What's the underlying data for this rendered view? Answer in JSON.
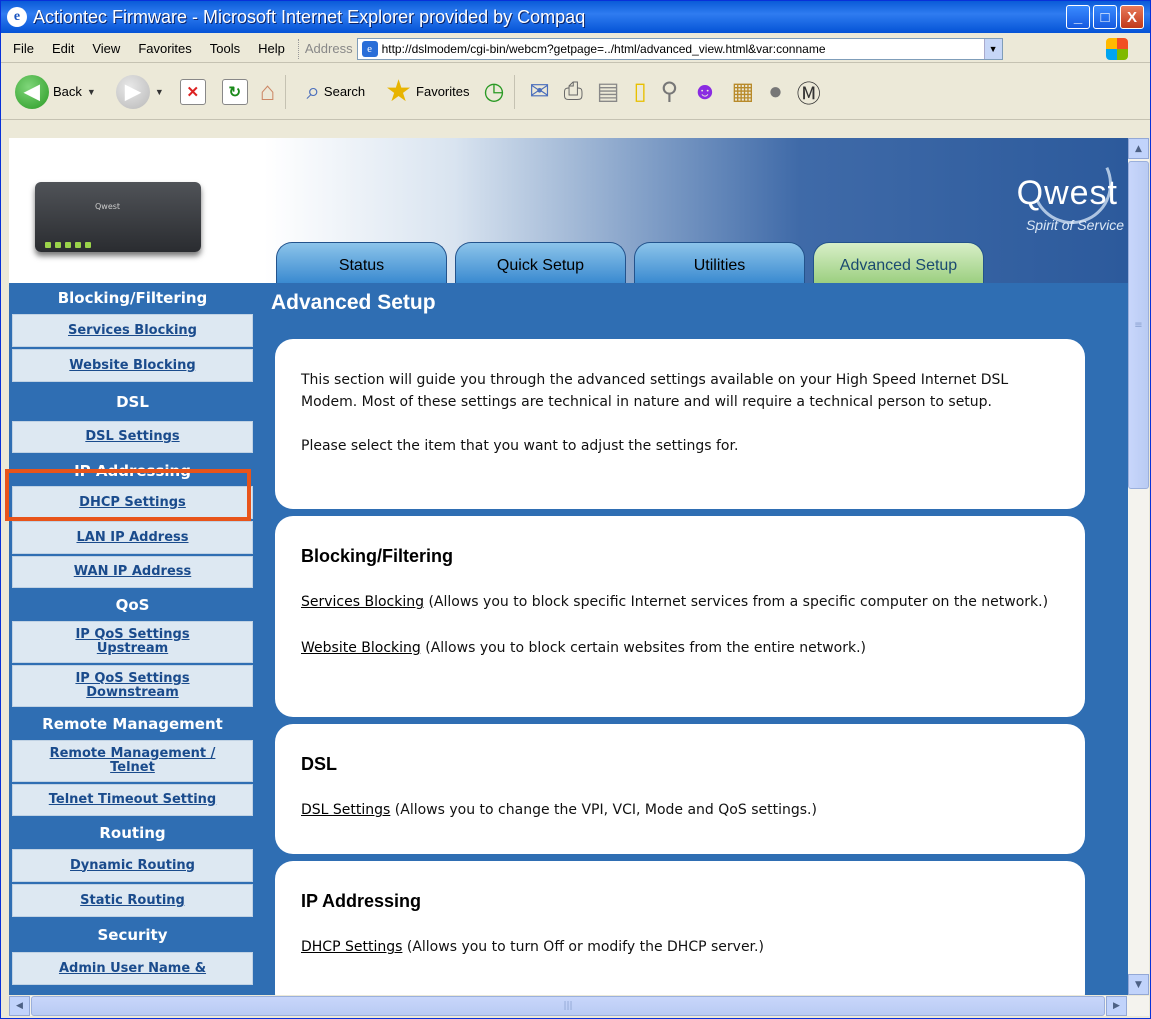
{
  "window": {
    "title": "Actiontec Firmware - Microsoft Internet Explorer provided by Compaq",
    "minimize": "_",
    "maximize": "□",
    "close": "X"
  },
  "menu": [
    "File",
    "Edit",
    "View",
    "Favorites",
    "Tools",
    "Help"
  ],
  "address": {
    "label": "Address",
    "url": "http://dslmodem/cgi-bin/webcm?getpage=../html/advanced_view.html&var:conname"
  },
  "toolbar": {
    "back": "Back",
    "search": "Search",
    "favorites": "Favorites"
  },
  "brand": {
    "name": "Qwest",
    "tagline": "Spirit of Service"
  },
  "modem": {
    "label": "Qwest"
  },
  "tabs": [
    "Status",
    "Quick Setup",
    "Utilities",
    "Advanced Setup"
  ],
  "active_tab": "Advanced Setup",
  "sidebar": [
    {
      "type": "head",
      "label": "Blocking/Filtering"
    },
    {
      "type": "link",
      "label": "Services Blocking"
    },
    {
      "type": "link",
      "label": "Website Blocking"
    },
    {
      "type": "head",
      "label": "DSL"
    },
    {
      "type": "link",
      "label": "DSL Settings"
    },
    {
      "type": "head",
      "label": "IP Addressing"
    },
    {
      "type": "link",
      "label": "DHCP Settings"
    },
    {
      "type": "link",
      "label": "LAN IP Address"
    },
    {
      "type": "link",
      "label": "WAN IP Address"
    },
    {
      "type": "head",
      "label": "QoS"
    },
    {
      "type": "link",
      "label": "IP QoS Settings Upstream"
    },
    {
      "type": "link",
      "label": "IP QoS Settings Downstream"
    },
    {
      "type": "head",
      "label": "Remote Management"
    },
    {
      "type": "link",
      "label": "Remote Management / Telnet"
    },
    {
      "type": "link",
      "label": "Telnet Timeout Setting"
    },
    {
      "type": "head",
      "label": "Routing"
    },
    {
      "type": "link",
      "label": "Dynamic Routing"
    },
    {
      "type": "link",
      "label": "Static Routing"
    },
    {
      "type": "head",
      "label": "Security"
    },
    {
      "type": "link",
      "label": "Admin User Name &"
    }
  ],
  "content": {
    "title": "Advanced Setup",
    "intro": "This section will guide you through the advanced settings available on your High Speed Internet DSL Modem. Most of these settings are technical in nature and will require a technical person to setup.",
    "instruction": "Please select the item that you want to adjust the settings for.",
    "sections": [
      {
        "heading": "Blocking/Filtering",
        "items": [
          {
            "link": "Services Blocking",
            "desc": "(Allows you to block specific Internet services from a specific computer on the network.)"
          },
          {
            "link": "Website Blocking",
            "desc": "(Allows you to block certain websites from the entire network.)"
          }
        ]
      },
      {
        "heading": "DSL",
        "items": [
          {
            "link": "DSL Settings",
            "desc": "(Allows you to change the VPI, VCI, Mode and QoS settings.)"
          }
        ]
      },
      {
        "heading": "IP Addressing",
        "items": [
          {
            "link": "DHCP Settings",
            "desc": "(Allows you to turn Off or modify the DHCP server.)"
          }
        ]
      }
    ]
  },
  "colors": {
    "page_bg": "#2f6eb3",
    "highlight": "#e8541a",
    "tab_active": "#9ccf80",
    "tab": "#3a8ad0"
  }
}
